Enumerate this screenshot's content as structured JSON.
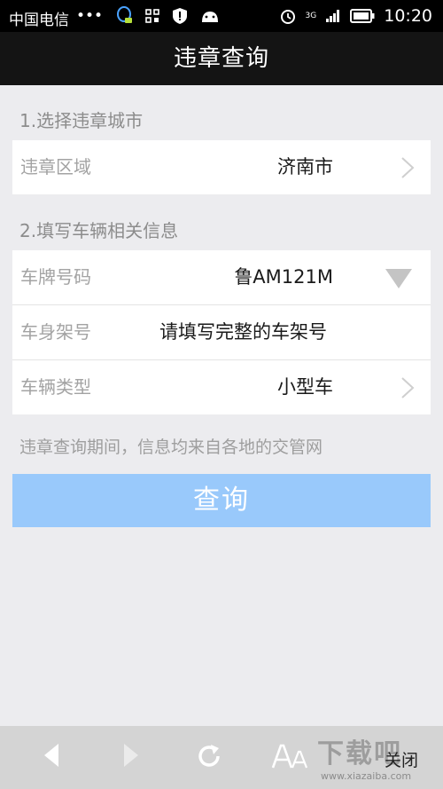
{
  "status_bar": {
    "carrier": "中国电信",
    "dots": "•••",
    "network": "3G",
    "time": "10:20"
  },
  "header": {
    "title": "违章查询"
  },
  "section1": {
    "title": "1.选择违章城市",
    "rows": [
      {
        "label": "违章区域",
        "value": "济南市"
      }
    ]
  },
  "section2": {
    "title": "2.填写车辆相关信息",
    "rows": [
      {
        "label": "车牌号码",
        "value": "鲁AM121M"
      },
      {
        "label": "车身架号",
        "placeholder": "请填写完整的车架号"
      },
      {
        "label": "车辆类型",
        "value": "小型车"
      }
    ]
  },
  "hint": "违章查询期间，信息均来自各地的交管网",
  "query_button": "查询",
  "bottom_bar": {
    "items": [
      "back-icon",
      "forward-icon",
      "refresh-icon",
      "font-size-icon"
    ],
    "close_label": "关闭"
  },
  "watermark": {
    "text": "下载吧",
    "url": "www.xiazaiba.com"
  },
  "colors": {
    "title_bar": "#141414",
    "background": "#ececef",
    "button": "#99c9fb",
    "bottom_bar": "#d4d4d4"
  }
}
